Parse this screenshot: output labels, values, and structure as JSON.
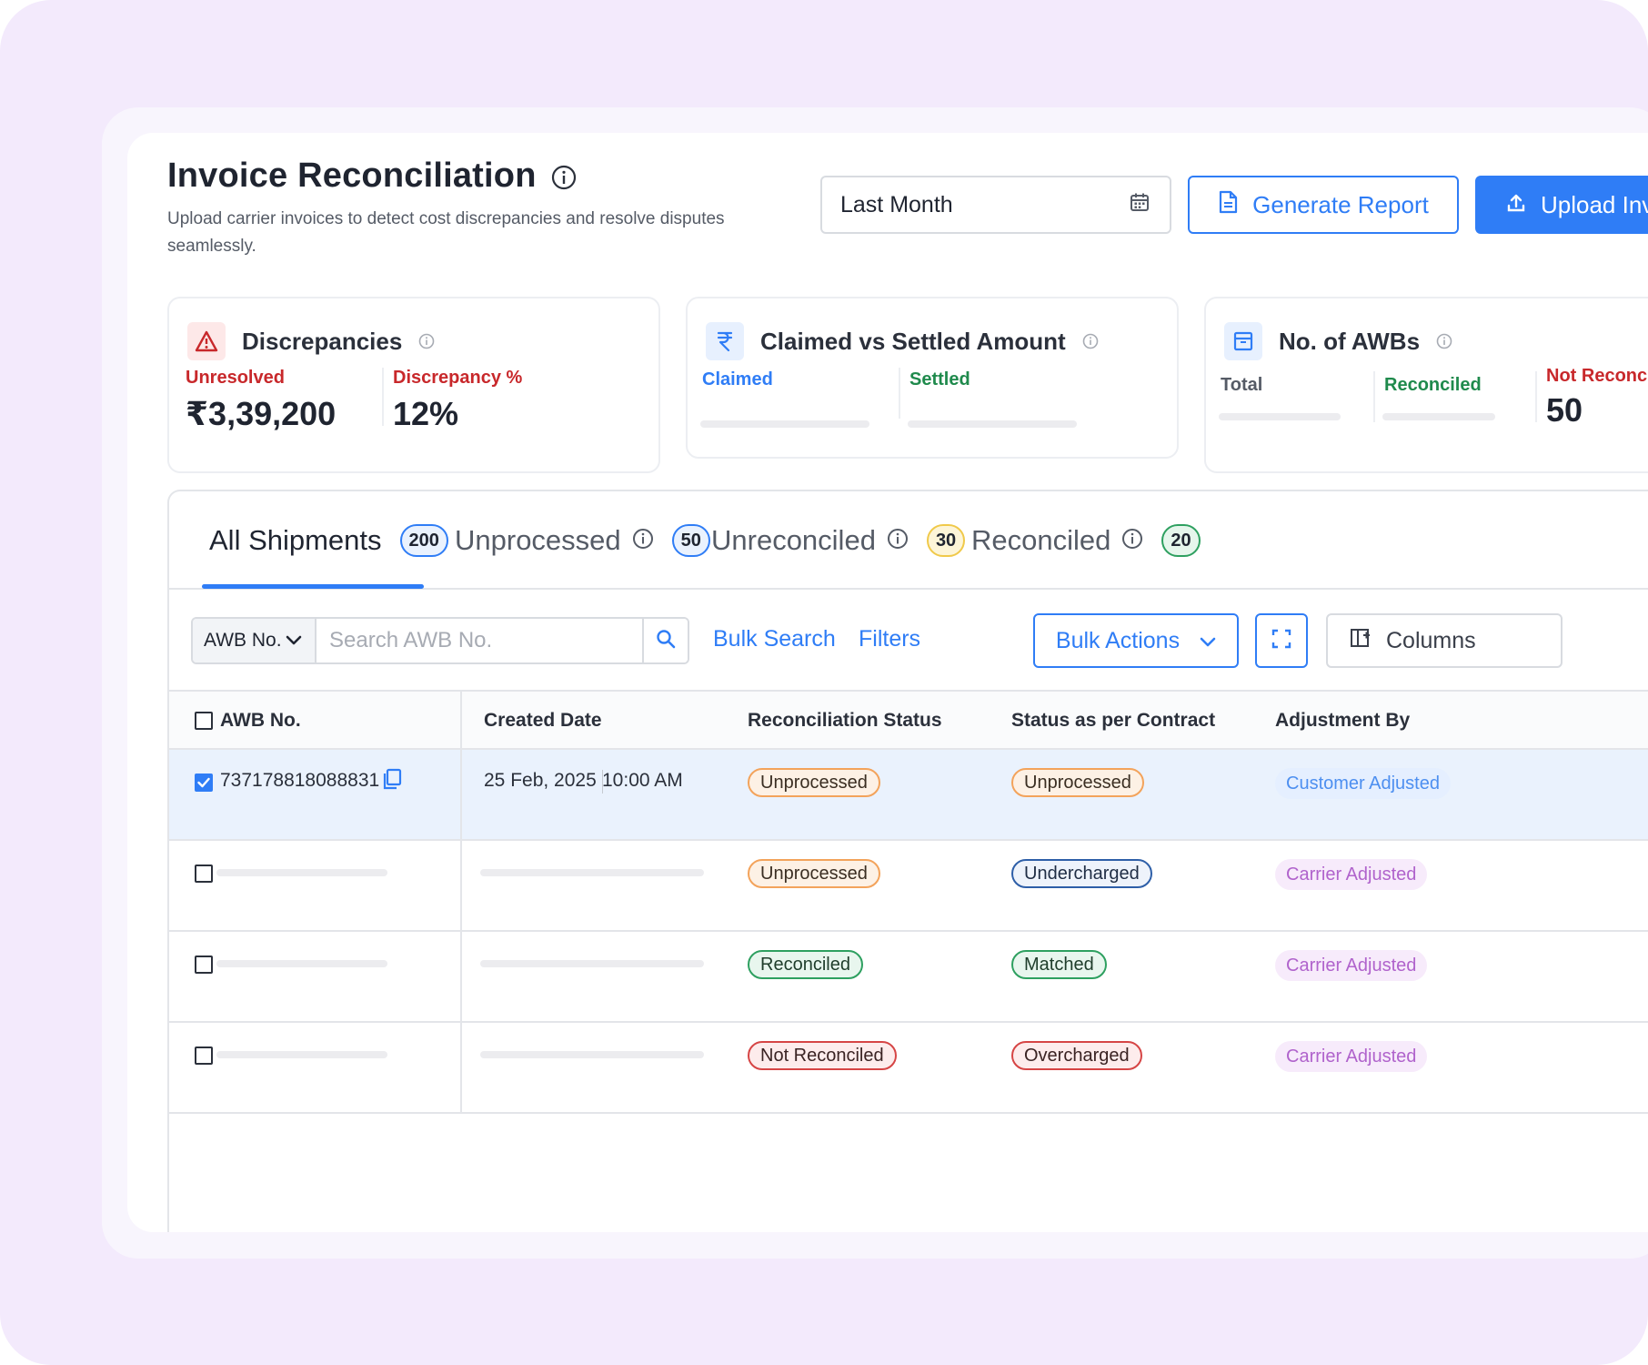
{
  "header": {
    "title": "Invoice Reconciliation",
    "subtitle": "Upload carrier invoices to detect cost discrepancies and resolve disputes seamlessly.",
    "date_range": "Last Month",
    "generate_report_label": "Generate Report",
    "upload_label": "Upload Invoice"
  },
  "cards": {
    "discrepancies": {
      "title": "Discrepancies",
      "unresolved_label": "Unresolved",
      "unresolved_value": "₹3,39,200",
      "percent_label": "Discrepancy %",
      "percent_value": "12%"
    },
    "claimed_settled": {
      "title": "Claimed vs Settled Amount",
      "claimed_label": "Claimed",
      "settled_label": "Settled"
    },
    "awbs": {
      "title": "No. of AWBs",
      "total_label": "Total",
      "reconciled_label": "Reconciled",
      "not_reconciled_label": "Not Reconciled",
      "not_reconciled_value": "50"
    }
  },
  "tabs": [
    {
      "label": "All Shipments",
      "count": "200"
    },
    {
      "label": "Unprocessed",
      "count": "50"
    },
    {
      "label": "Unreconciled",
      "count": "30"
    },
    {
      "label": "Reconciled",
      "count": "20"
    }
  ],
  "toolbar": {
    "search_type": "AWB No.",
    "search_placeholder": "Search AWB No.",
    "bulk_search_label": "Bulk Search",
    "filters_label": "Filters",
    "bulk_actions_label": "Bulk Actions",
    "columns_label": "Columns"
  },
  "table": {
    "headers": [
      "AWB No.",
      "Created Date",
      "Reconciliation Status",
      "Status as per Contract",
      "Adjustment By"
    ],
    "rows": [
      {
        "awb": "737178818088831",
        "date": "25 Feb, 2025",
        "time": "10:00 AM",
        "recon_status": "Unprocessed",
        "contract_status": "Unprocessed",
        "adjustment": "Customer Adjusted"
      },
      {
        "recon_status": "Unprocessed",
        "contract_status": "Undercharged",
        "adjustment": "Carrier Adjusted"
      },
      {
        "recon_status": "Reconciled",
        "contract_status": "Matched",
        "adjustment": "Carrier Adjusted"
      },
      {
        "recon_status": "Not Reconciled",
        "contract_status": "Overcharged",
        "adjustment": "Carrier Adjusted"
      }
    ]
  },
  "colors": {
    "accent": "#2f7df6",
    "unresolved": "#c8282b",
    "reconciled": "#1f8a4c",
    "claimed": "#2f7df6"
  }
}
